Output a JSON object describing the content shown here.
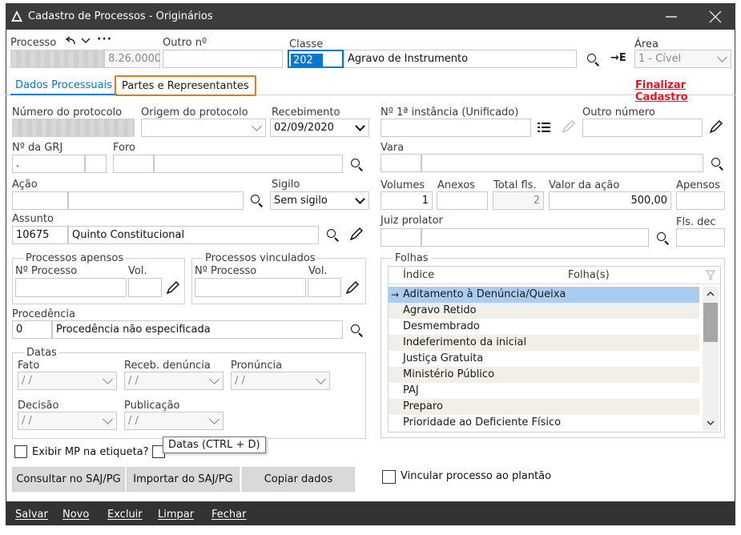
{
  "window": {
    "title": "Cadastro de Processos - Originários"
  },
  "header": {
    "processo_label": "Processo",
    "processo_suffix": "8.26.0000",
    "outro_numero_label": "Outro nº",
    "classe_label": "Classe",
    "classe_code": "202",
    "classe_desc": "Agravo de Instrumento",
    "area_label": "Área",
    "area_value": "1 - Cível"
  },
  "tabs": [
    {
      "label": "Dados Processuais"
    },
    {
      "label": "Partes e Representantes"
    }
  ],
  "finalizar_label": "Finalizar Cadastro",
  "form": {
    "numero_protocolo_label": "Número do protocolo",
    "origem_protocolo_label": "Origem do protocolo",
    "recebimento_label": "Recebimento",
    "recebimento_value": "02/09/2020",
    "instancia_label": "Nº 1ª instância (Unificado)",
    "outro_numero_label": "Outro número",
    "grj_label": "Nº da GRJ",
    "grj_value": ".",
    "foro_label": "Foro",
    "vara_label": "Vara",
    "acao_label": "Ação",
    "sigilo_label": "Sigilo",
    "sigilo_value": "Sem sigilo",
    "volumes_label": "Volumes",
    "volumes_value": "1",
    "anexos_label": "Anexos",
    "total_fls_label": "Total fls.",
    "total_fls_value": "2",
    "valor_acao_label": "Valor da ação",
    "valor_acao_value": "500,00",
    "apensos_label": "Apensos",
    "assunto_label": "Assunto",
    "assunto_code": "10675",
    "assunto_desc": "Quinto Constitucional",
    "juiz_label": "Juiz prolator",
    "fls_dec_label": "Fls. dec",
    "apensos_group_label": "Processos apensos",
    "vinculados_group_label": "Processos vinculados",
    "n_processo_label": "Nº Processo",
    "vol_label": "Vol.",
    "procedencia_label": "Procedência",
    "procedencia_code": "0",
    "procedencia_desc": "Procedência não especificada",
    "datas_group_label": "Datas",
    "fato_label": "Fato",
    "receb_denuncia_label": "Receb. denúncia",
    "pronuncia_label": "Pronúncia",
    "decisao_label": "Decisão",
    "publicacao_label": "Publicação",
    "date_placeholder": "/ /",
    "exibir_mp_label": "Exibir MP na etiqueta?",
    "tooltip_text": "Datas (CTRL + D)",
    "vincular_label": "Vincular processo ao plantão"
  },
  "folhas": {
    "group_label": "Folhas",
    "col_indice": "Índice",
    "col_folhas": "Folha(s)",
    "items": [
      "Aditamento à Denúncia/Queixa",
      "Agravo Retido",
      "Desmembrado",
      "Indeferimento da inicial",
      "Justiça Gratuita",
      "Ministério Público",
      "PAJ",
      "Preparo",
      "Prioridade ao Deficiente Físico"
    ]
  },
  "buttons": {
    "consultar": "Consultar no SAJ/PG",
    "importar": "Importar do SAJ/PG",
    "copiar": "Copiar dados"
  },
  "bottombar": {
    "salvar": "Salvar",
    "novo": "Novo",
    "excluir": "Excluir",
    "limpar": "Limpar",
    "fechar": "Fechar"
  },
  "colors": {
    "accent": "#0078d7",
    "tab_highlight": "#e07b1f",
    "finalizar": "#e81123",
    "selection": "#a9cdf0"
  }
}
